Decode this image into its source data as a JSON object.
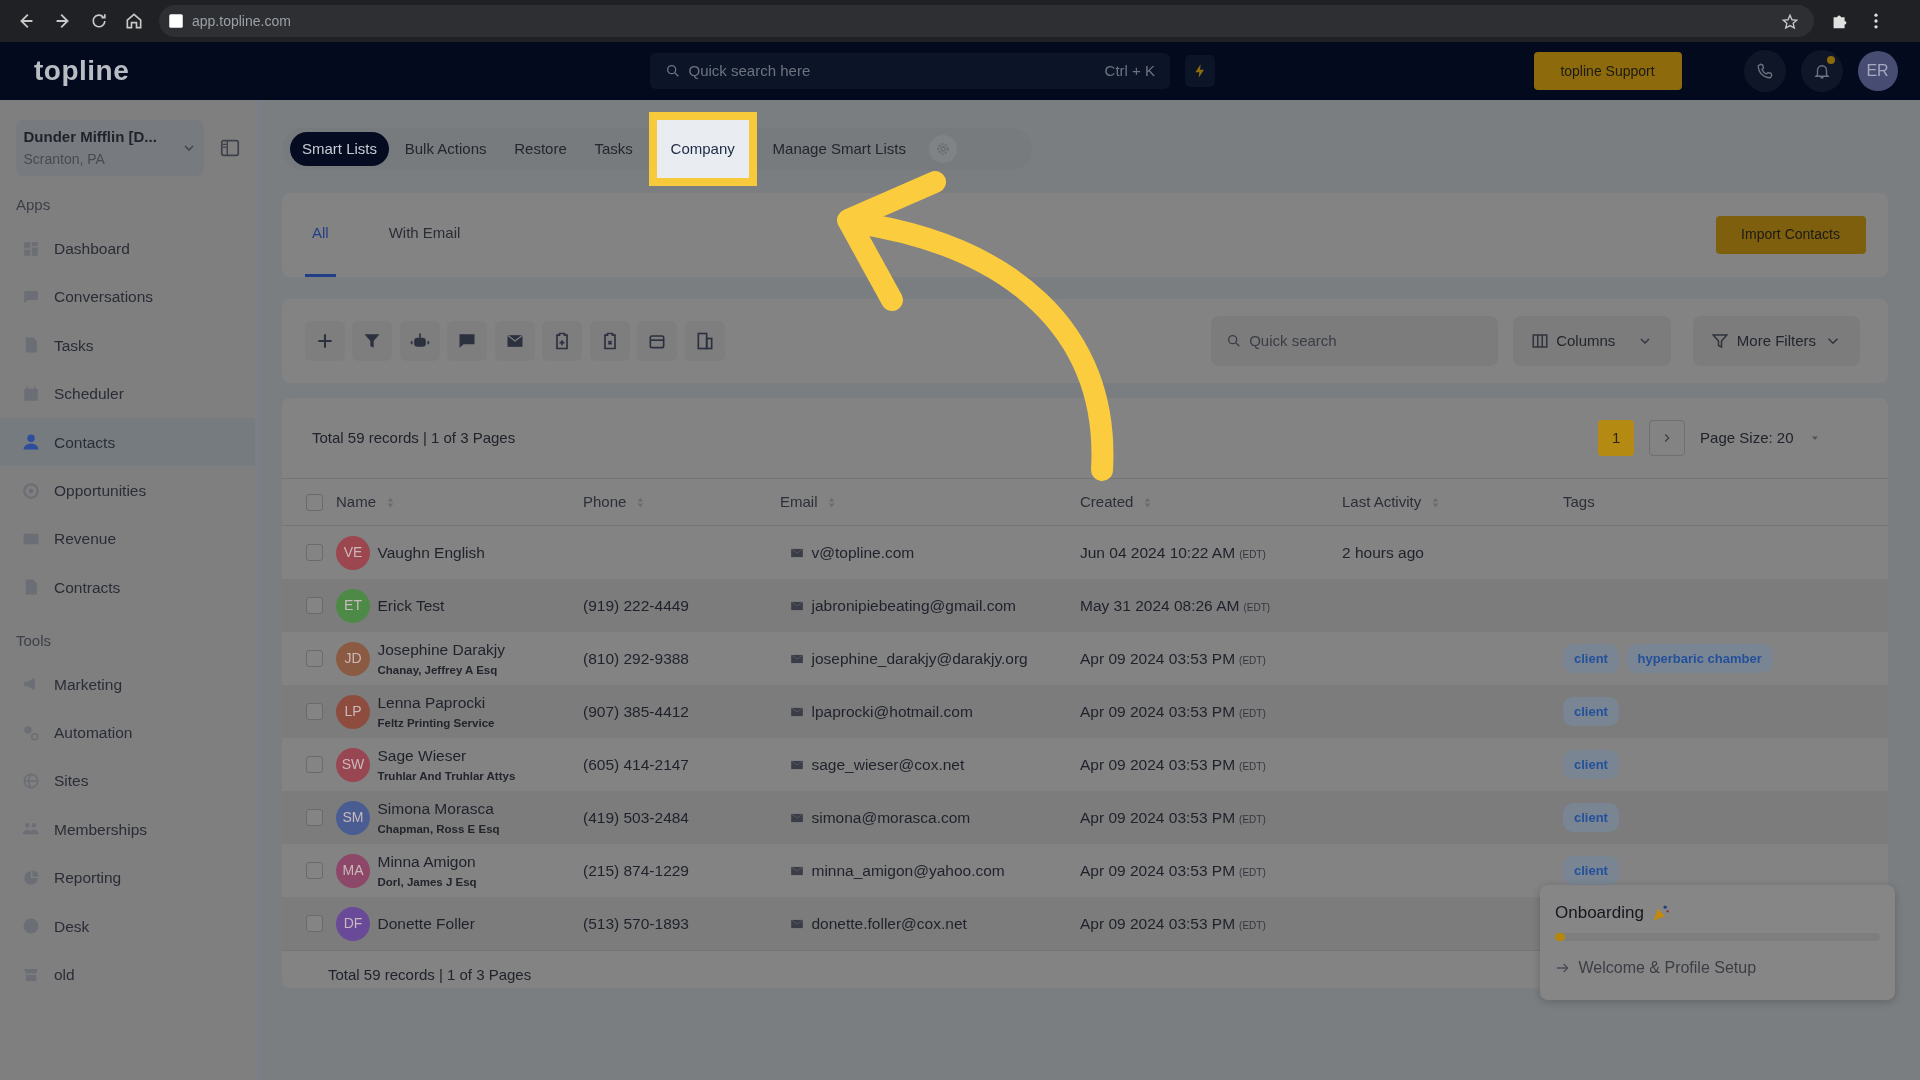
{
  "browser": {
    "url": "app.topline.com"
  },
  "topbar": {
    "logo": "topline",
    "search_placeholder": "Quick search here",
    "shortcut": "Ctrl + K",
    "support_button": "topline Support",
    "avatar": "ER"
  },
  "account": {
    "name": "Dunder Mifflin [D...",
    "location": "Scranton, PA"
  },
  "sidebar": {
    "sections": [
      {
        "title": "Apps",
        "items": [
          {
            "label": "Dashboard",
            "selected": false
          },
          {
            "label": "Conversations",
            "selected": false
          },
          {
            "label": "Tasks",
            "selected": false
          },
          {
            "label": "Scheduler",
            "selected": false
          },
          {
            "label": "Contacts",
            "selected": true
          },
          {
            "label": "Opportunities",
            "selected": false
          },
          {
            "label": "Revenue",
            "selected": false
          },
          {
            "label": "Contracts",
            "selected": false
          }
        ]
      },
      {
        "title": "Tools",
        "items": [
          {
            "label": "Marketing",
            "selected": false
          },
          {
            "label": "Automation",
            "selected": false
          },
          {
            "label": "Sites",
            "selected": false
          },
          {
            "label": "Memberships",
            "selected": false
          },
          {
            "label": "Reporting",
            "selected": false
          },
          {
            "label": "Desk",
            "selected": false
          },
          {
            "label": "old",
            "selected": false
          }
        ]
      }
    ]
  },
  "top_tabs": [
    {
      "label": "Smart Lists",
      "selected": true,
      "highlighted": false
    },
    {
      "label": "Bulk Actions",
      "selected": false,
      "highlighted": false
    },
    {
      "label": "Restore",
      "selected": false,
      "highlighted": false
    },
    {
      "label": "Tasks",
      "selected": false,
      "highlighted": false
    },
    {
      "label": "Company",
      "selected": false,
      "highlighted": true
    },
    {
      "label": "Manage Smart Lists",
      "selected": false,
      "highlighted": false
    }
  ],
  "list_tabs": [
    {
      "label": "All",
      "selected": true
    },
    {
      "label": "With Email",
      "selected": false
    }
  ],
  "import_button": "Import Contacts",
  "toolbar": {
    "search_placeholder": "Quick search",
    "columns_button": "Columns",
    "filters_button": "More Filters"
  },
  "records_summary_top": "Total 59 records | 1 of 3 Pages",
  "pagination": {
    "pages": [
      {
        "label": "1",
        "selected": true
      }
    ],
    "page_size": "Page Size: 20"
  },
  "table": {
    "header_checked": false,
    "columns": [
      {
        "label": "Name",
        "sortable": true
      },
      {
        "label": "Phone",
        "sortable": true
      },
      {
        "label": "Email",
        "sortable": true
      },
      {
        "label": "Created",
        "sortable": true
      },
      {
        "label": "Last Activity",
        "sortable": true
      },
      {
        "label": "Tags",
        "sortable": false
      }
    ],
    "rows": [
      {
        "checked": false,
        "initials": "VE",
        "color": "#9c4650",
        "name": "Vaughn English",
        "company": "",
        "phone": "",
        "email": "v@topline.com",
        "created": "Jun 04 2024 10:22 AM",
        "timezone": "(EDT)",
        "last_activity": "2 hours ago",
        "tags": []
      },
      {
        "checked": false,
        "initials": "ET",
        "color": "#4e8a47",
        "name": "Erick Test",
        "company": "",
        "phone": "(919) 222-4449",
        "email": "jabronipiebeating@gmail.com",
        "created": "May 31 2024 08:26 AM",
        "timezone": "(EDT)",
        "last_activity": "",
        "tags": []
      },
      {
        "checked": false,
        "initials": "JD",
        "color": "#8b5a42",
        "name": "Josephine Darakjy",
        "company": "Chanay, Jeffrey A Esq",
        "phone": "(810) 292-9388",
        "email": "josephine_darakjy@darakjy.org",
        "created": "Apr 09 2024 03:53 PM",
        "timezone": "(EDT)",
        "last_activity": "",
        "tags": [
          "client",
          "hyperbaric chamber"
        ]
      },
      {
        "checked": false,
        "initials": "LP",
        "color": "#8e4c3e",
        "name": "Lenna Paprocki",
        "company": "Feltz Printing Service",
        "phone": "(907) 385-4412",
        "email": "lpaprocki@hotmail.com",
        "created": "Apr 09 2024 03:53 PM",
        "timezone": "(EDT)",
        "last_activity": "",
        "tags": [
          "client"
        ]
      },
      {
        "checked": false,
        "initials": "SW",
        "color": "#984651",
        "name": "Sage Wieser",
        "company": "Truhlar And Truhlar Attys",
        "phone": "(605) 414-2147",
        "email": "sage_wieser@cox.net",
        "created": "Apr 09 2024 03:53 PM",
        "timezone": "(EDT)",
        "last_activity": "",
        "tags": [
          "client"
        ]
      },
      {
        "checked": false,
        "initials": "SM",
        "color": "#4a5d92",
        "name": "Simona Morasca",
        "company": "Chapman, Ross E Esq",
        "phone": "(419) 503-2484",
        "email": "simona@morasca.com",
        "created": "Apr 09 2024 03:53 PM",
        "timezone": "(EDT)",
        "last_activity": "",
        "tags": [
          "client"
        ]
      },
      {
        "checked": false,
        "initials": "MA",
        "color": "#8d4768",
        "name": "Minna Amigon",
        "company": "Dorl, James J Esq",
        "phone": "(215) 874-1229",
        "email": "minna_amigon@yahoo.com",
        "created": "Apr 09 2024 03:53 PM",
        "timezone": "(EDT)",
        "last_activity": "",
        "tags": [
          "client"
        ]
      },
      {
        "checked": false,
        "initials": "DF",
        "color": "#684a98",
        "name": "Donette Foller",
        "company": "",
        "phone": "(513) 570-1893",
        "email": "donette.foller@cox.net",
        "created": "Apr 09 2024 03:53 PM",
        "timezone": "(EDT)",
        "last_activity": "",
        "tags": []
      }
    ]
  },
  "records_summary_bottom": "Total 59 records | 1 of 3 Pages",
  "onboarding": {
    "title": "Onboarding",
    "level": 0.03,
    "step": "Welcome & Profile Setup"
  }
}
